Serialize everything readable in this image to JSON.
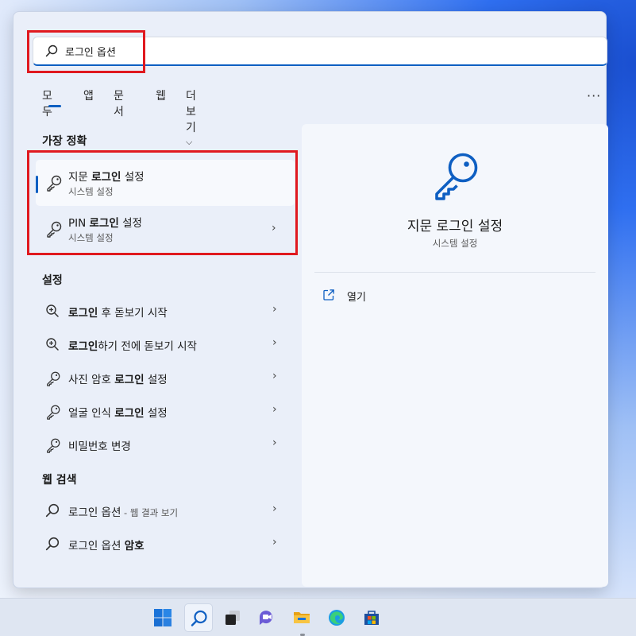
{
  "search": {
    "value": "로그인 옵션"
  },
  "tabs": [
    {
      "label": "모두",
      "active": true
    },
    {
      "label": "앱"
    },
    {
      "label": "문서"
    },
    {
      "label": "웹"
    },
    {
      "label": "더 보기"
    }
  ],
  "more_glyph": "···",
  "best_match": {
    "title": "가장 정확",
    "items": [
      {
        "title_pre": "지문 ",
        "title_bold": "로그인",
        "title_post": " 설정",
        "subtitle": "시스템 설정",
        "icon": "key-icon"
      },
      {
        "title_pre": "PIN ",
        "title_bold": "로그인",
        "title_post": " 설정",
        "subtitle": "시스템 설정",
        "icon": "key-icon"
      }
    ]
  },
  "settings": {
    "title": "설정",
    "items": [
      {
        "pre": "",
        "bold": "로그인",
        "post": " 후 돋보기 시작",
        "icon": "magnifier-plus-icon"
      },
      {
        "pre": "",
        "bold": "로그인",
        "post": "하기 전에 돋보기 시작",
        "icon": "magnifier-plus-icon"
      },
      {
        "pre": "사진 암호 ",
        "bold": "로그인",
        "post": " 설정",
        "icon": "key-icon"
      },
      {
        "pre": "얼굴 인식 ",
        "bold": "로그인",
        "post": " 설정",
        "icon": "key-icon"
      },
      {
        "pre": "비밀번호 변경",
        "bold": "",
        "post": "",
        "icon": "key-icon"
      }
    ]
  },
  "web": {
    "title": "웹 검색",
    "items": [
      {
        "label": "로그인 옵션",
        "suffix": " - 웹 결과 보기",
        "bold": ""
      },
      {
        "label": "로그인 옵션 ",
        "suffix": "",
        "bold": "암호"
      }
    ]
  },
  "detail": {
    "title": "지문 로그인 설정",
    "subtitle": "시스템 설정",
    "open_label": "열기"
  },
  "colors": {
    "accent": "#0e5fc2",
    "highlight": "#e0191f"
  },
  "taskbar": [
    "windows-start",
    "search",
    "task-view",
    "chat",
    "file-explorer",
    "edge",
    "store"
  ]
}
